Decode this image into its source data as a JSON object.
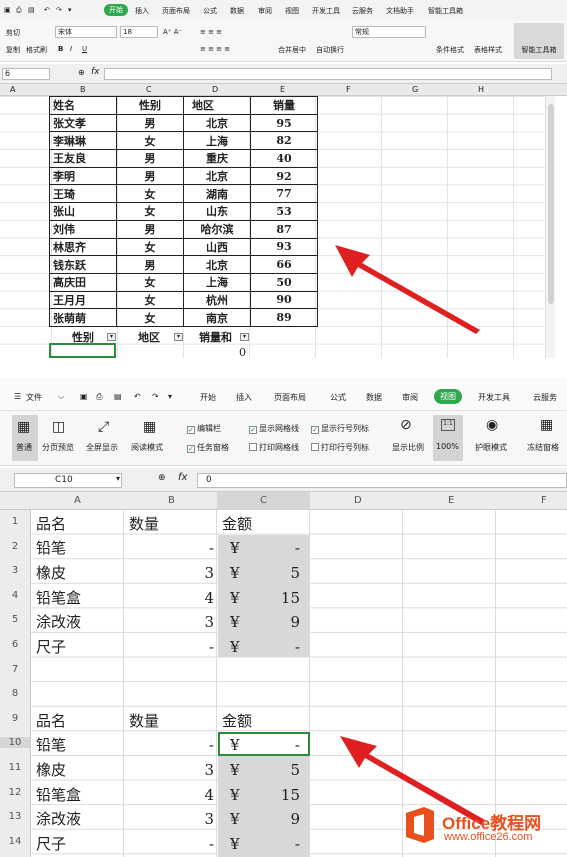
{
  "top": {
    "tabs": [
      "开始",
      "插入",
      "页面布局",
      "公式",
      "数据",
      "审阅",
      "视图",
      "开发工具",
      "云服务",
      "文档助手",
      "智能工具箱"
    ],
    "active_tab": "开始",
    "ribbon": {
      "cut": "剪切",
      "copy": "复制",
      "format_painter": "格式刷",
      "font": "宋体",
      "font_size": "18",
      "merge": "合并居中",
      "wrap": "自动换行",
      "number_format": "常规",
      "conditional": "条件格式",
      "table_style": "表格样式",
      "smart_toolbox": "智能工具箱"
    },
    "name_box": "6",
    "fx": "fx",
    "col_headers": [
      "A",
      "B",
      "C",
      "D",
      "E",
      "F",
      "G",
      "H"
    ],
    "table": {
      "headers": [
        "姓名",
        "性别",
        "地区",
        "销量"
      ],
      "rows": [
        [
          "张文孝",
          "男",
          "北京",
          "95"
        ],
        [
          "李琳琳",
          "女",
          "上海",
          "82"
        ],
        [
          "王友良",
          "男",
          "重庆",
          "40"
        ],
        [
          "李明",
          "男",
          "北京",
          "92"
        ],
        [
          "王琦",
          "女",
          "湖南",
          "77"
        ],
        [
          "张山",
          "女",
          "山东",
          "53"
        ],
        [
          "刘伟",
          "男",
          "哈尔滨",
          "87"
        ],
        [
          "林思齐",
          "女",
          "山西",
          "93"
        ],
        [
          "钱东跃",
          "男",
          "北京",
          "66"
        ],
        [
          "高庆田",
          "女",
          "上海",
          "50"
        ],
        [
          "王月月",
          "女",
          "杭州",
          "90"
        ],
        [
          "张萌萌",
          "女",
          "南京",
          "89"
        ]
      ]
    },
    "pivot": {
      "labels": [
        "性别",
        "地区",
        "销量和"
      ],
      "value": "0"
    }
  },
  "bottom": {
    "file_menu": "文件",
    "tabs": [
      "开始",
      "插入",
      "页面布局",
      "公式",
      "数据",
      "审阅",
      "视图",
      "开发工具",
      "云服务"
    ],
    "active_tab": "视图",
    "ribbon": {
      "normal": "普通",
      "page_break": "分页预览",
      "full_screen": "全屏显示",
      "reading": "阅读模式",
      "edit_bar": "编辑栏",
      "task_pane": "任务窗格",
      "show_grid": "显示网格线",
      "print_grid": "打印网格线",
      "show_rowcol": "显示行号列标",
      "print_rowcol": "打印行号列标",
      "zoom": "显示比例",
      "zoom_100": "100%",
      "eye": "护眼模式",
      "freeze": "冻结窗格"
    },
    "name_box": "C10",
    "fx": "fx",
    "formula": "0",
    "col_headers": [
      "A",
      "B",
      "C",
      "D",
      "E",
      "F"
    ],
    "row_numbers": [
      "1",
      "2",
      "3",
      "4",
      "5",
      "6",
      "7",
      "8",
      "9",
      "10",
      "11",
      "12",
      "13",
      "14"
    ],
    "block1": {
      "headers": [
        "品名",
        "数量",
        "金额"
      ],
      "rows": [
        [
          "铅笔",
          "-",
          "¥",
          "-"
        ],
        [
          "橡皮",
          "3",
          "¥",
          "5"
        ],
        [
          "铅笔盒",
          "4",
          "¥",
          "15"
        ],
        [
          "涂改液",
          "3",
          "¥",
          "9"
        ],
        [
          "尺子",
          "-",
          "¥",
          "-"
        ]
      ]
    },
    "block2": {
      "headers": [
        "品名",
        "数量",
        "金额"
      ],
      "rows": [
        [
          "铅笔",
          "-",
          "¥",
          "-"
        ],
        [
          "橡皮",
          "3",
          "¥",
          "5"
        ],
        [
          "铅笔盒",
          "4",
          "¥",
          "15"
        ],
        [
          "涂改液",
          "3",
          "¥",
          "9"
        ],
        [
          "尺子",
          "-",
          "¥",
          "-"
        ]
      ]
    }
  },
  "watermark": {
    "brand": "Office教程网",
    "url": "www.office26.com"
  },
  "colors": {
    "accent": "#2fa84f",
    "arrow": "#e02020",
    "logo": "#e8501e"
  }
}
